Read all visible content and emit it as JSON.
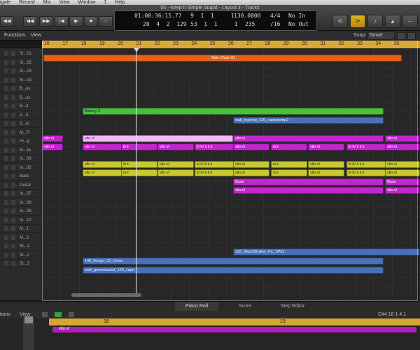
{
  "menubar": {
    "items": [
      "igate",
      "Record",
      "Mix",
      "View",
      "Window",
      "1",
      "Help"
    ]
  },
  "window": {
    "title": "05 - Keep It Simple Stupid - Layout 3 - Tracks"
  },
  "lcd": {
    "row1": {
      "time": "01:00:36:15.77",
      "bars": "9  1  1     1",
      "tempo": "130.0000",
      "sig": "4/4",
      "in": "No In"
    },
    "row2": {
      "time": "20  4  2  129",
      "bars": "53  1  1     1",
      "tempo": "235",
      "sig": "/16",
      "out": "No Out"
    }
  },
  "subtoolbar": {
    "functions": "Functions",
    "view": "View",
    "snap_label": "Snap:",
    "snap_value": "Smart"
  },
  "ruler": {
    "bars": [
      "16",
      "17",
      "18",
      "19",
      "20",
      "21",
      "22",
      "23",
      "24",
      "25",
      "26",
      "27",
      "28",
      "29",
      "30",
      "31",
      "32",
      "33",
      "34",
      "35"
    ]
  },
  "tracks": [
    "Si...01",
    "Si...02",
    "Si...03",
    "Si...04",
    "B...us",
    "B...us",
    "B...3",
    "A...3",
    "S...er",
    "M...R",
    "Hi...g",
    "M...es",
    "In...03",
    "In...02",
    "Bass",
    "Guitar",
    "In...07",
    "In...08",
    "In...09",
    "In...10",
    "M...1",
    "M...2",
    "St...1",
    "St...2",
    "St...3"
  ],
  "regions": {
    "sidechain": "Side Chain 01",
    "battery": "Battery 3",
    "toploop": "walt_toploop_126_captainstrp2",
    "vlio": "vlio vl",
    "iii": "iii ii",
    "iiiv": "iii IV ii ii ii",
    "bass": "Bass",
    "wood": "120_WoodShaker_FX_SP01",
    "bongo": "140_Bongo_03_Close",
    "groove": "walt_grooveassist_126_capri"
  },
  "tabs": {
    "piano": "Piano Roll",
    "score": "Score",
    "step": "Step Editor"
  },
  "editor": {
    "functions": "tions",
    "view": "View",
    "position": "C#4   18 1 4 1",
    "region_label": "vlio vl",
    "ruler_start": "18",
    "ruler_mid": "19"
  }
}
